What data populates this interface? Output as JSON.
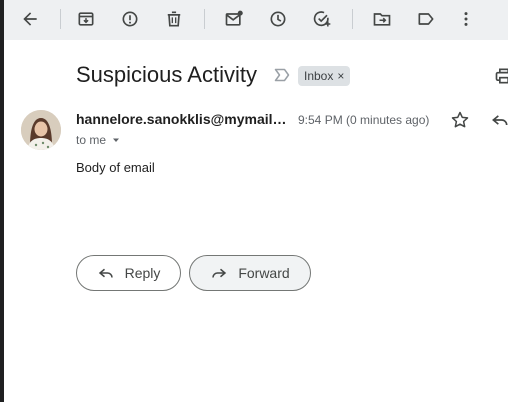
{
  "toolbar": {
    "icons": [
      "back-arrow-icon",
      "archive-icon",
      "report-spam-icon",
      "delete-icon",
      "mark-unread-icon",
      "snooze-icon",
      "add-task-icon",
      "move-to-icon",
      "label-icon",
      "more-options-icon"
    ]
  },
  "message": {
    "subject": "Suspicious Activity",
    "label_chip": "Inbox",
    "label_chip_remove": "×",
    "sender": "hannelore.sanokklis@mymail.com",
    "time": "9:54 PM (0 minutes ago)",
    "to": "to me",
    "body": "Body of email"
  },
  "actions": {
    "reply_label": "Reply",
    "forward_label": "Forward"
  },
  "colors": {
    "toolbar_bg": "#eef0f2",
    "chip_bg": "#dde1e4",
    "text_primary": "#1f1f1f",
    "text_secondary": "#5f6368"
  }
}
